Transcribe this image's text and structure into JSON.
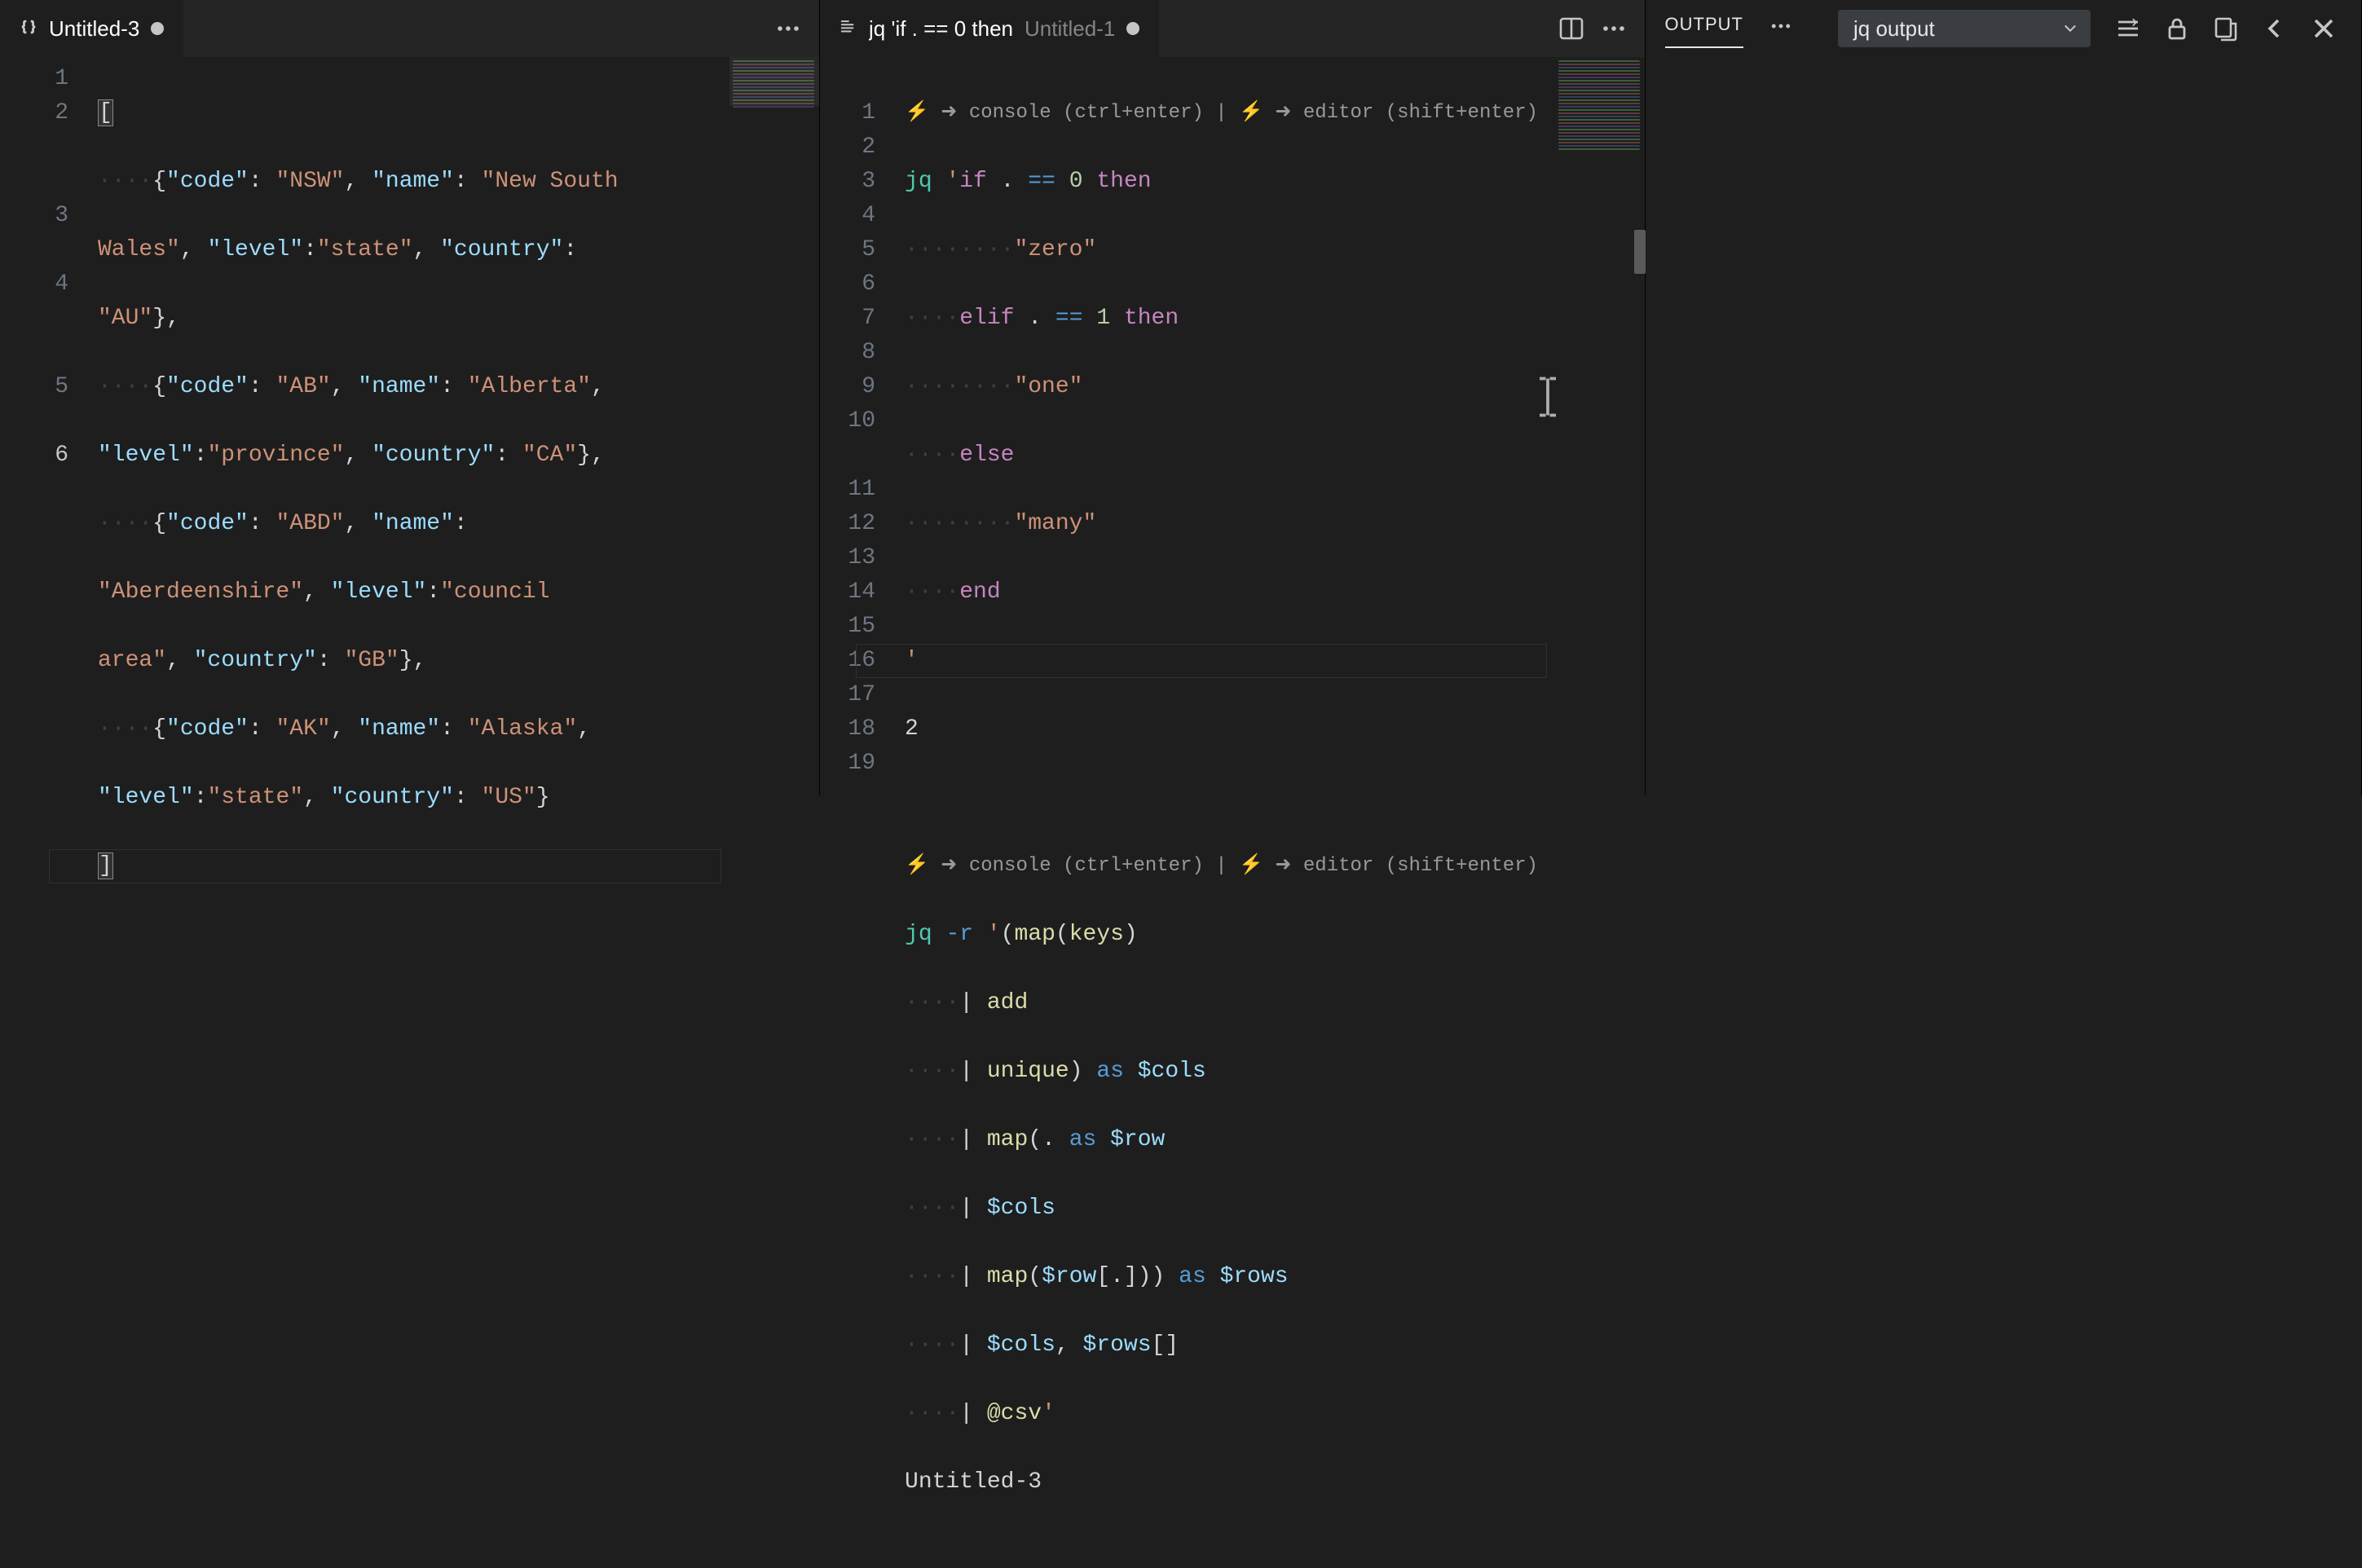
{
  "group1": {
    "tab": {
      "title": "Untitled-3",
      "dirty": true,
      "icon": "braces-icon"
    },
    "code": {
      "lines": [
        {
          "n": 1,
          "raw": "["
        },
        {
          "n": 2,
          "segments": [
            {
              "ws": "····"
            },
            {
              "p": "{"
            },
            {
              "k": "\"code\""
            },
            {
              "p": ": "
            },
            {
              "s": "\"NSW\""
            },
            {
              "p": ", "
            },
            {
              "k": "\"name\""
            },
            {
              "p": ": "
            },
            {
              "s": "\"New South Wales\""
            },
            {
              "p": ", "
            },
            {
              "k": "\"level\""
            },
            {
              "p": ":"
            },
            {
              "s": "\"state\""
            },
            {
              "p": ", "
            },
            {
              "k": "\"country\""
            },
            {
              "p": ": "
            },
            {
              "s": "\"AU\""
            },
            {
              "p": "},"
            }
          ]
        },
        {
          "n": 3,
          "segments": [
            {
              "ws": "····"
            },
            {
              "p": "{"
            },
            {
              "k": "\"code\""
            },
            {
              "p": ": "
            },
            {
              "s": "\"AB\""
            },
            {
              "p": ", "
            },
            {
              "k": "\"name\""
            },
            {
              "p": ": "
            },
            {
              "s": "\"Alberta\""
            },
            {
              "p": ", "
            },
            {
              "k": "\"level\""
            },
            {
              "p": ":"
            },
            {
              "s": "\"province\""
            },
            {
              "p": ", "
            },
            {
              "k": "\"country\""
            },
            {
              "p": ": "
            },
            {
              "s": "\"CA\""
            },
            {
              "p": "},"
            }
          ]
        },
        {
          "n": 4,
          "segments": [
            {
              "ws": "····"
            },
            {
              "p": "{"
            },
            {
              "k": "\"code\""
            },
            {
              "p": ": "
            },
            {
              "s": "\"ABD\""
            },
            {
              "p": ", "
            },
            {
              "k": "\"name\""
            },
            {
              "p": ": "
            },
            {
              "s": "\"Aberdeenshire\""
            },
            {
              "p": ", "
            },
            {
              "k": "\"level\""
            },
            {
              "p": ":"
            },
            {
              "s": "\"council area\""
            },
            {
              "p": ", "
            },
            {
              "k": "\"country\""
            },
            {
              "p": ": "
            },
            {
              "s": "\"GB\""
            },
            {
              "p": "},"
            }
          ]
        },
        {
          "n": 5,
          "segments": [
            {
              "ws": "····"
            },
            {
              "p": "{"
            },
            {
              "k": "\"code\""
            },
            {
              "p": ": "
            },
            {
              "s": "\"AK\""
            },
            {
              "p": ", "
            },
            {
              "k": "\"name\""
            },
            {
              "p": ": "
            },
            {
              "s": "\"Alaska\""
            },
            {
              "p": ", "
            },
            {
              "k": "\"level\""
            },
            {
              "p": ":"
            },
            {
              "s": "\"state\""
            },
            {
              "p": ", "
            },
            {
              "k": "\"country\""
            },
            {
              "p": ": "
            },
            {
              "s": "\"US\""
            },
            {
              "p": "}"
            }
          ]
        },
        {
          "n": 6,
          "raw": "]"
        }
      ]
    }
  },
  "group2": {
    "tab": {
      "kind": "jq",
      "title": "jq 'if . == 0 then",
      "sub": "Untitled-1",
      "dirty": true
    },
    "codelens": "⚡ ➜ console (ctrl+enter) | ⚡ ➜ editor (shift+enter)",
    "codeA_lines": [
      {
        "n": 1,
        "t": "jq 'if . == 0 then"
      },
      {
        "n": 2,
        "t": "        \"zero\""
      },
      {
        "n": 3,
        "t": "    elif . == 1 then"
      },
      {
        "n": 4,
        "t": "        \"one\""
      },
      {
        "n": 5,
        "t": "    else"
      },
      {
        "n": 6,
        "t": "        \"many\""
      },
      {
        "n": 7,
        "t": "    end"
      },
      {
        "n": 8,
        "t": "'"
      },
      {
        "n": 9,
        "t": "2"
      },
      {
        "n": 10,
        "t": ""
      }
    ],
    "codeB_lines": [
      {
        "n": 11,
        "t": "jq -r '(map(keys)"
      },
      {
        "n": 12,
        "t": "    | add"
      },
      {
        "n": 13,
        "t": "    | unique) as $cols"
      },
      {
        "n": 14,
        "t": "    | map(. as $row"
      },
      {
        "n": 15,
        "t": "    | $cols"
      },
      {
        "n": 16,
        "t": "    | map($row[.])) as $rows"
      },
      {
        "n": 17,
        "t": "    | $cols, $rows[]"
      },
      {
        "n": 18,
        "t": "    | @csv'"
      },
      {
        "n": 19,
        "t": "Untitled-3"
      }
    ]
  },
  "output": {
    "tab": "OUTPUT",
    "channel": "jq output"
  },
  "codelens_parts": {
    "console": "console (ctrl+enter)",
    "editor": "editor (shift+enter)"
  }
}
